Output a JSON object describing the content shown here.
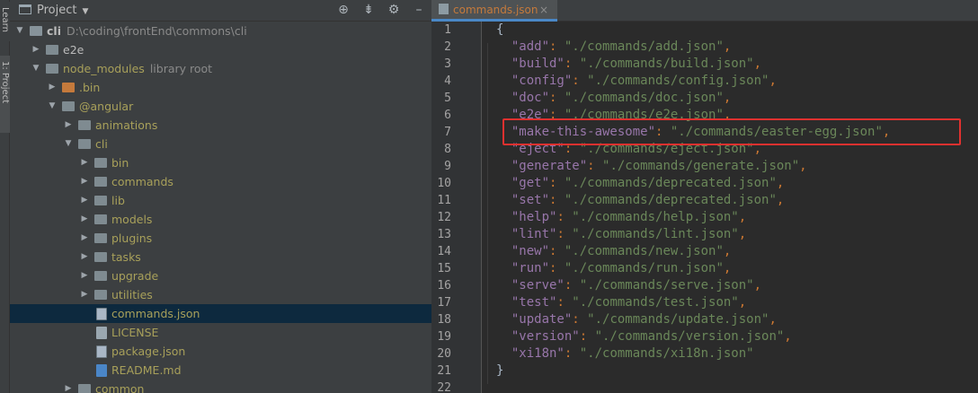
{
  "toolstrip": {
    "learn_label": "Learn",
    "project_label": "1: Project"
  },
  "project_panel": {
    "title": "Project",
    "tools": [
      "crosshair-icon",
      "collapse-icon",
      "gear-icon",
      "hide-icon"
    ]
  },
  "tree": [
    {
      "label": "cli",
      "extra": "D:\\coding\\frontEnd\\commons\\cli",
      "depth": 0,
      "expanded": true,
      "kind": "folder-dark",
      "bold": true
    },
    {
      "label": "e2e",
      "extra": "",
      "depth": 1,
      "expanded": false,
      "kind": "folder"
    },
    {
      "label": "node_modules",
      "extra": "library root",
      "depth": 1,
      "expanded": true,
      "kind": "folder",
      "olive": true
    },
    {
      "label": ".bin",
      "extra": "",
      "depth": 2,
      "expanded": false,
      "kind": "folder-orange",
      "olive": true
    },
    {
      "label": "@angular",
      "extra": "",
      "depth": 2,
      "expanded": true,
      "kind": "folder",
      "olive": true
    },
    {
      "label": "animations",
      "extra": "",
      "depth": 3,
      "expanded": false,
      "kind": "folder",
      "olive": true
    },
    {
      "label": "cli",
      "extra": "",
      "depth": 3,
      "expanded": true,
      "kind": "folder",
      "olive": true
    },
    {
      "label": "bin",
      "extra": "",
      "depth": 4,
      "expanded": false,
      "kind": "folder",
      "olive": true
    },
    {
      "label": "commands",
      "extra": "",
      "depth": 4,
      "expanded": false,
      "kind": "folder",
      "olive": true
    },
    {
      "label": "lib",
      "extra": "",
      "depth": 4,
      "expanded": false,
      "kind": "folder",
      "olive": true
    },
    {
      "label": "models",
      "extra": "",
      "depth": 4,
      "expanded": false,
      "kind": "folder",
      "olive": true
    },
    {
      "label": "plugins",
      "extra": "",
      "depth": 4,
      "expanded": false,
      "kind": "folder",
      "olive": true
    },
    {
      "label": "tasks",
      "extra": "",
      "depth": 4,
      "expanded": false,
      "kind": "folder",
      "olive": true
    },
    {
      "label": "upgrade",
      "extra": "",
      "depth": 4,
      "expanded": false,
      "kind": "folder",
      "olive": true
    },
    {
      "label": "utilities",
      "extra": "",
      "depth": 4,
      "expanded": false,
      "kind": "folder",
      "olive": true
    },
    {
      "label": "commands.json",
      "extra": "",
      "depth": 4,
      "kind": "json",
      "olive": true,
      "selected": true
    },
    {
      "label": "LICENSE",
      "extra": "",
      "depth": 4,
      "kind": "file",
      "olive": true
    },
    {
      "label": "package.json",
      "extra": "",
      "depth": 4,
      "kind": "json",
      "olive": true
    },
    {
      "label": "README.md",
      "extra": "",
      "depth": 4,
      "kind": "md",
      "olive": true
    },
    {
      "label": "common",
      "extra": "",
      "depth": 3,
      "expanded": false,
      "kind": "folder",
      "olive": true
    }
  ],
  "editor": {
    "tab_label": "commands.json",
    "highlighted_line": 7,
    "lines": [
      {
        "n": "1",
        "open": "{"
      },
      {
        "n": "2",
        "key": "\"add\"",
        "val": "\"./commands/add.json\""
      },
      {
        "n": "3",
        "key": "\"build\"",
        "val": "\"./commands/build.json\""
      },
      {
        "n": "4",
        "key": "\"config\"",
        "val": "\"./commands/config.json\""
      },
      {
        "n": "5",
        "key": "\"doc\"",
        "val": "\"./commands/doc.json\""
      },
      {
        "n": "6",
        "key": "\"e2e\"",
        "val": "\"./commands/e2e.json\""
      },
      {
        "n": "7",
        "key": "\"make-this-awesome\"",
        "val": "\"./commands/easter-egg.json\""
      },
      {
        "n": "8",
        "key": "\"eject\"",
        "val": "\"./commands/eject.json\""
      },
      {
        "n": "9",
        "key": "\"generate\"",
        "val": "\"./commands/generate.json\""
      },
      {
        "n": "10",
        "key": "\"get\"",
        "val": "\"./commands/deprecated.json\""
      },
      {
        "n": "11",
        "key": "\"set\"",
        "val": "\"./commands/deprecated.json\""
      },
      {
        "n": "12",
        "key": "\"help\"",
        "val": "\"./commands/help.json\""
      },
      {
        "n": "13",
        "key": "\"lint\"",
        "val": "\"./commands/lint.json\""
      },
      {
        "n": "14",
        "key": "\"new\"",
        "val": "\"./commands/new.json\""
      },
      {
        "n": "15",
        "key": "\"run\"",
        "val": "\"./commands/run.json\""
      },
      {
        "n": "16",
        "key": "\"serve\"",
        "val": "\"./commands/serve.json\""
      },
      {
        "n": "17",
        "key": "\"test\"",
        "val": "\"./commands/test.json\""
      },
      {
        "n": "18",
        "key": "\"update\"",
        "val": "\"./commands/update.json\""
      },
      {
        "n": "19",
        "key": "\"version\"",
        "val": "\"./commands/version.json\""
      },
      {
        "n": "20",
        "key": "\"xi18n\"",
        "val": "\"./commands/xi18n.json\"",
        "last": true
      },
      {
        "n": "21",
        "close": "}"
      },
      {
        "n": "22"
      }
    ]
  }
}
